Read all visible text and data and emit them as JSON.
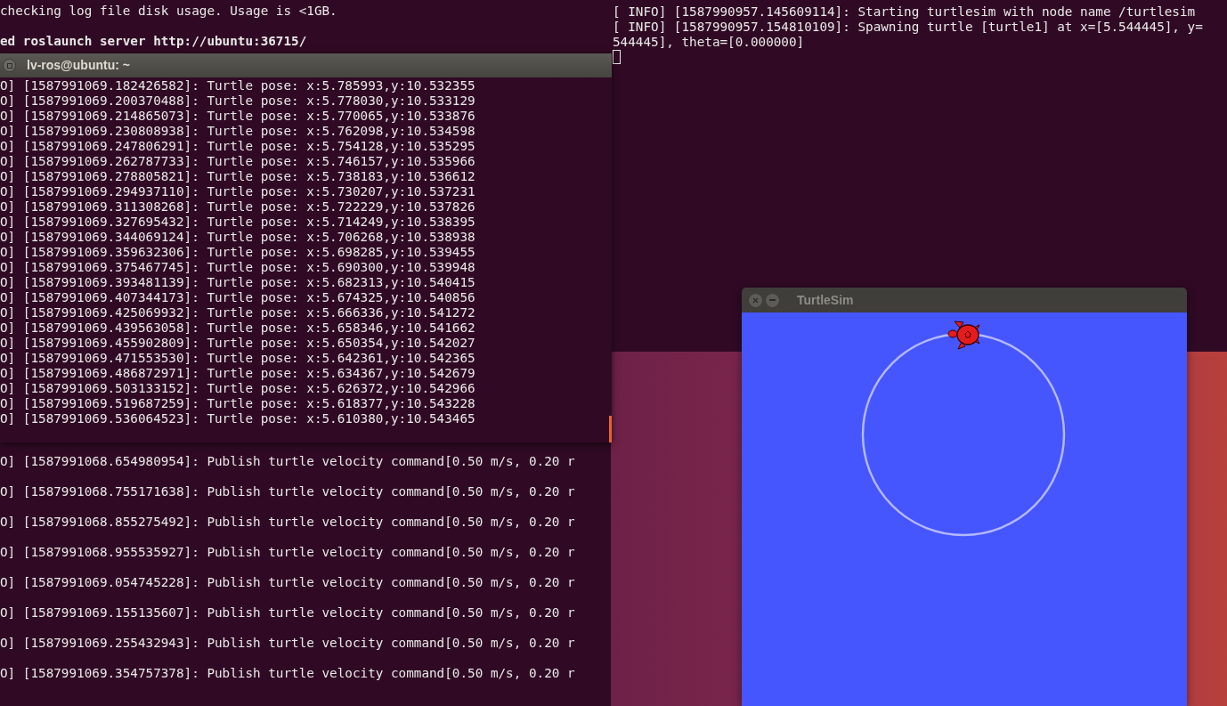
{
  "background_terminal": {
    "log_message": "checking log file disk usage. Usage is <1GB.",
    "server_message": "ed roslaunch server http://ubuntu:36715/"
  },
  "turtlesim_terminal": {
    "lines": [
      "[ INFO] [1587990957.145609114]: Starting turtlesim with node name /turtlesim",
      "[ INFO] [1587990957.154810109]: Spawning turtle [turtle1] at x=[5.544445], y=",
      "544445], theta=[0.000000]"
    ]
  },
  "pose_terminal": {
    "title": "lv-ros@ubuntu: ~",
    "lines": [
      "O] [1587991069.182426582]: Turtle pose: x:5.785993,y:10.532355",
      "O] [1587991069.200370488]: Turtle pose: x:5.778030,y:10.533129",
      "O] [1587991069.214865073]: Turtle pose: x:5.770065,y:10.533876",
      "O] [1587991069.230808938]: Turtle pose: x:5.762098,y:10.534598",
      "O] [1587991069.247806291]: Turtle pose: x:5.754128,y:10.535295",
      "O] [1587991069.262787733]: Turtle pose: x:5.746157,y:10.535966",
      "O] [1587991069.278805821]: Turtle pose: x:5.738183,y:10.536612",
      "O] [1587991069.294937110]: Turtle pose: x:5.730207,y:10.537231",
      "O] [1587991069.311308268]: Turtle pose: x:5.722229,y:10.537826",
      "O] [1587991069.327695432]: Turtle pose: x:5.714249,y:10.538395",
      "O] [1587991069.344069124]: Turtle pose: x:5.706268,y:10.538938",
      "O] [1587991069.359632306]: Turtle pose: x:5.698285,y:10.539455",
      "O] [1587991069.375467745]: Turtle pose: x:5.690300,y:10.539948",
      "O] [1587991069.393481139]: Turtle pose: x:5.682313,y:10.540415",
      "O] [1587991069.407344173]: Turtle pose: x:5.674325,y:10.540856",
      "O] [1587991069.425069932]: Turtle pose: x:5.666336,y:10.541272",
      "O] [1587991069.439563058]: Turtle pose: x:5.658346,y:10.541662",
      "O] [1587991069.455902809]: Turtle pose: x:5.650354,y:10.542027",
      "O] [1587991069.471553530]: Turtle pose: x:5.642361,y:10.542365",
      "O] [1587991069.486872971]: Turtle pose: x:5.634367,y:10.542679",
      "O] [1587991069.503133152]: Turtle pose: x:5.626372,y:10.542966",
      "O] [1587991069.519687259]: Turtle pose: x:5.618377,y:10.543228",
      "O] [1587991069.536064523]: Turtle pose: x:5.610380,y:10.543465"
    ]
  },
  "command_terminal": {
    "lines": [
      "O] [1587991068.654980954]: Publish turtle velocity command[0.50 m/s, 0.20 r",
      "O] [1587991068.755171638]: Publish turtle velocity command[0.50 m/s, 0.20 r",
      "O] [1587991068.855275492]: Publish turtle velocity command[0.50 m/s, 0.20 r",
      "O] [1587991068.955535927]: Publish turtle velocity command[0.50 m/s, 0.20 r",
      "O] [1587991069.054745228]: Publish turtle velocity command[0.50 m/s, 0.20 r",
      "O] [1587991069.155135607]: Publish turtle velocity command[0.50 m/s, 0.20 r",
      "O] [1587991069.255432943]: Publish turtle velocity command[0.50 m/s, 0.20 r",
      "O] [1587991069.354757378]: Publish turtle velocity command[0.50 m/s, 0.20 r"
    ]
  },
  "turtlesim_window": {
    "title": "TurtleSim"
  }
}
